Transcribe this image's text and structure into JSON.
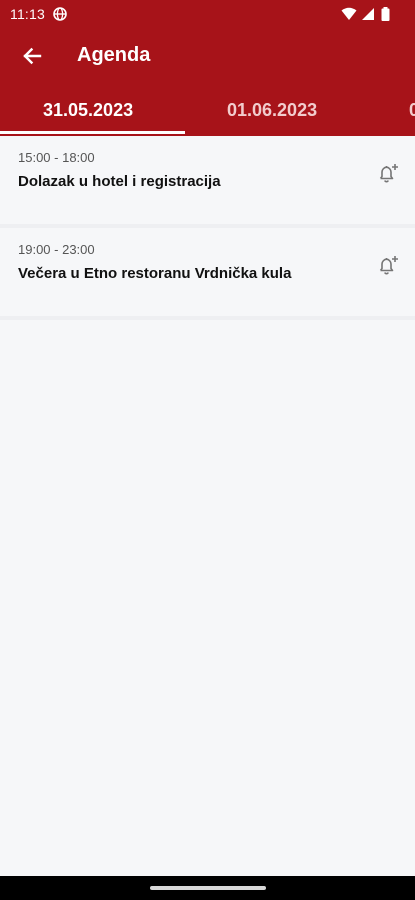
{
  "status_bar": {
    "time": "11:13"
  },
  "header": {
    "title": "Agenda"
  },
  "tabs": [
    {
      "label": "31.05.2023",
      "active": true
    },
    {
      "label": "01.06.2023",
      "active": false
    },
    {
      "label": "0",
      "active": false
    }
  ],
  "agenda": [
    {
      "time": "15:00 - 18:00",
      "title": "Dolazak u hotel i registracija"
    },
    {
      "time": "19:00 - 23:00",
      "title": "Večera u Etno restoranu Vrdnička kula"
    }
  ],
  "colors": {
    "primary": "#a71319",
    "background": "#f6f7f9"
  }
}
